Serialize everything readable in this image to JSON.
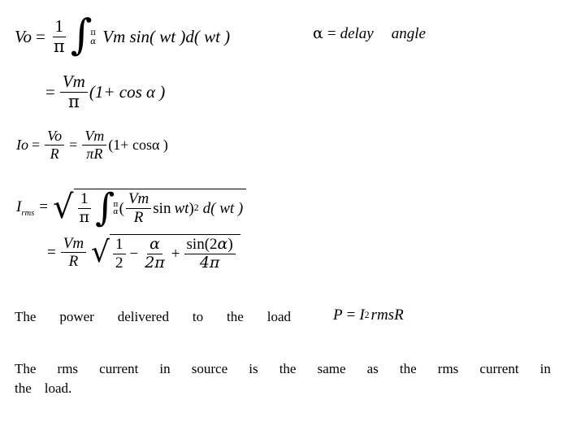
{
  "slide": {
    "background": "#ffffff",
    "text_color": "#000000"
  },
  "equations": {
    "vo_integral": {
      "lhs": "Vo",
      "eq": "=",
      "coef_num": "1",
      "coef_den": "π",
      "integral_upper": "π",
      "integral_lower": "α",
      "integrand": "Vm sin( wt )d( wt )"
    },
    "vo_result": {
      "eq": "=",
      "num": "Vm",
      "den": "π",
      "tail": "(1+ cos α )"
    },
    "io": {
      "lhs": "Io",
      "eq1": "=",
      "num1": "Vo",
      "den1": "R",
      "eq2": "=",
      "num2": "Vm",
      "den2": "πR",
      "tail": "(1+ cosα )"
    },
    "irms_integral": {
      "lhs": "I",
      "lhs_sub": "rms",
      "eq": "=",
      "coef_num": "1",
      "coef_den": "π",
      "integral_upper": "π",
      "integral_lower": "α",
      "open_paren": "(",
      "inner_num": "Vm",
      "inner_den": "R",
      "inner_fn": "sin",
      "inner_arg": "wt",
      "close_paren": ")",
      "power": "2",
      "differential": "d( wt )"
    },
    "irms_result": {
      "eq": "=",
      "num": "Vm",
      "den": "R",
      "t1_num": "1",
      "t1_den": "2",
      "op1": "−",
      "t2_num": "α",
      "t2_den": "2π",
      "op2": "+",
      "t3_num_fn": "sin(2",
      "t3_num_alpha": "α",
      "t3_num_close": ")",
      "t3_den": "4π"
    },
    "power": {
      "lhs": "P",
      "eq": "=",
      "current": "I",
      "power_exp": "2",
      "rms_label": "rms",
      "resistance": "R"
    }
  },
  "annotations": {
    "delay_angle": {
      "symbol": "α",
      "eq": "=",
      "word1": "delay",
      "word2": "angle"
    }
  },
  "text_blocks": {
    "power_statement": {
      "words": [
        "The",
        "power",
        "delivered",
        "to",
        "the",
        "load"
      ]
    },
    "rms_statement": {
      "line1_words": [
        "The",
        "rms",
        "current",
        "in",
        "source",
        "is",
        "the",
        "same",
        "as",
        "the",
        "rms",
        "current",
        "in"
      ],
      "line2_words": [
        "the",
        "load."
      ]
    }
  }
}
